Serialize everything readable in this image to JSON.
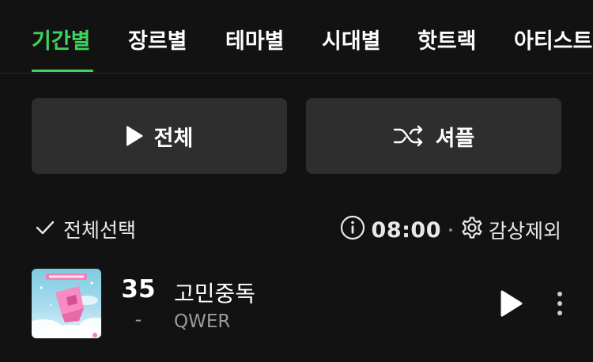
{
  "tabs": [
    {
      "label": "기간별",
      "active": true
    },
    {
      "label": "장르별",
      "active": false
    },
    {
      "label": "테마별",
      "active": false
    },
    {
      "label": "시대별",
      "active": false
    },
    {
      "label": "핫트랙",
      "active": false
    },
    {
      "label": "아티스트",
      "active": false
    }
  ],
  "colors": {
    "accent": "#3fd35b",
    "background": "#121212",
    "button_bg": "#2e2e2e"
  },
  "actions": {
    "play_all_label": "전체",
    "shuffle_label": "셔플"
  },
  "toolbar": {
    "select_all_label": "전체선택",
    "timer_value": "08:00",
    "exclude_label": "감상제외"
  },
  "tracks": [
    {
      "rank": "35",
      "rank_change": "-",
      "title": "고민중독",
      "artist": "QWER"
    }
  ],
  "icons": {
    "play": "play-icon",
    "shuffle": "shuffle-icon",
    "check": "check-icon",
    "info": "info-icon",
    "settings": "gear-icon",
    "more": "more-vertical-icon"
  }
}
